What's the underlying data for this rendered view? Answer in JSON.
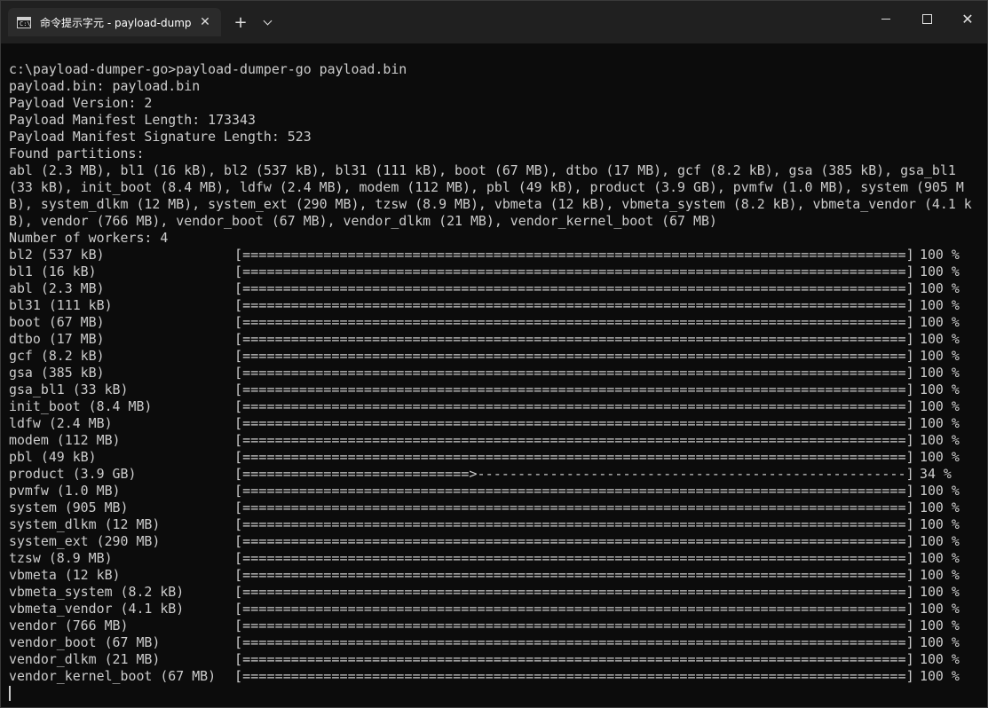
{
  "window": {
    "tab_title": "命令提示字元 - payload-dump",
    "tab_icon_text": "C:\\",
    "close_tab_glyph": "✕",
    "new_tab_glyph": "+",
    "close_glyph": "✕"
  },
  "terminal": {
    "header_lines": [
      "c:\\payload-dumper-go>payload-dumper-go payload.bin",
      "payload.bin: payload.bin",
      "Payload Version: 2",
      "Payload Manifest Length: 173343",
      "Payload Manifest Signature Length: 523",
      "Found partitions:"
    ],
    "partitions_text": "abl (2.3 MB), bl1 (16 kB), bl2 (537 kB), bl31 (111 kB), boot (67 MB), dtbo (17 MB), gcf (8.2 kB), gsa (385 kB), gsa_bl1 (33 kB), init_boot (8.4 MB), ldfw (2.4 MB), modem (112 MB), pbl (49 kB), product (3.9 GB), pvmfw (1.0 MB), system (905 MB), system_dlkm (12 MB), system_ext (290 MB), tzsw (8.9 MB), vbmeta (12 kB), vbmeta_system (8.2 kB), vbmeta_vendor (4.1 kB), vendor (766 MB), vendor_boot (67 MB), vendor_dlkm (21 MB), vendor_kernel_boot (67 MB)",
    "workers_line": "Number of workers: 4",
    "progress": [
      {
        "name": "bl2 (537 kB)",
        "bar": "[==================================================================================]",
        "pct": "100 %",
        "value": 100
      },
      {
        "name": "bl1 (16 kB)",
        "bar": "[==================================================================================]",
        "pct": "100 %",
        "value": 100
      },
      {
        "name": "abl (2.3 MB)",
        "bar": "[==================================================================================]",
        "pct": "100 %",
        "value": 100
      },
      {
        "name": "bl31 (111 kB)",
        "bar": "[==================================================================================]",
        "pct": "100 %",
        "value": 100
      },
      {
        "name": "boot (67 MB)",
        "bar": "[==================================================================================]",
        "pct": "100 %",
        "value": 100
      },
      {
        "name": "dtbo (17 MB)",
        "bar": "[==================================================================================]",
        "pct": "100 %",
        "value": 100
      },
      {
        "name": "gcf (8.2 kB)",
        "bar": "[==================================================================================]",
        "pct": "100 %",
        "value": 100
      },
      {
        "name": "gsa (385 kB)",
        "bar": "[==================================================================================]",
        "pct": "100 %",
        "value": 100
      },
      {
        "name": "gsa_bl1 (33 kB)",
        "bar": "[==================================================================================]",
        "pct": "100 %",
        "value": 100
      },
      {
        "name": "init_boot (8.4 MB)",
        "bar": "[==================================================================================]",
        "pct": "100 %",
        "value": 100
      },
      {
        "name": "ldfw (2.4 MB)",
        "bar": "[==================================================================================]",
        "pct": "100 %",
        "value": 100
      },
      {
        "name": "modem (112 MB)",
        "bar": "[==================================================================================]",
        "pct": "100 %",
        "value": 100
      },
      {
        "name": "pbl (49 kB)",
        "bar": "[==================================================================================]",
        "pct": "100 %",
        "value": 100
      },
      {
        "name": "product (3.9 GB)",
        "bar": "[============================>-----------------------------------------------------]",
        "pct": "34 %",
        "value": 34
      },
      {
        "name": "pvmfw (1.0 MB)",
        "bar": "[==================================================================================]",
        "pct": "100 %",
        "value": 100
      },
      {
        "name": "system (905 MB)",
        "bar": "[==================================================================================]",
        "pct": "100 %",
        "value": 100
      },
      {
        "name": "system_dlkm (12 MB)",
        "bar": "[==================================================================================]",
        "pct": "100 %",
        "value": 100
      },
      {
        "name": "system_ext (290 MB)",
        "bar": "[==================================================================================]",
        "pct": "100 %",
        "value": 100
      },
      {
        "name": "tzsw (8.9 MB)",
        "bar": "[==================================================================================]",
        "pct": "100 %",
        "value": 100
      },
      {
        "name": "vbmeta (12 kB)",
        "bar": "[==================================================================================]",
        "pct": "100 %",
        "value": 100
      },
      {
        "name": "vbmeta_system (8.2 kB)",
        "bar": "[==================================================================================]",
        "pct": "100 %",
        "value": 100
      },
      {
        "name": "vbmeta_vendor (4.1 kB)",
        "bar": "[==================================================================================]",
        "pct": "100 %",
        "value": 100
      },
      {
        "name": "vendor (766 MB)",
        "bar": "[==================================================================================]",
        "pct": "100 %",
        "value": 100
      },
      {
        "name": "vendor_boot (67 MB)",
        "bar": "[==================================================================================]",
        "pct": "100 %",
        "value": 100
      },
      {
        "name": "vendor_dlkm (21 MB)",
        "bar": "[==================================================================================]",
        "pct": "100 %",
        "value": 100
      },
      {
        "name": "vendor_kernel_boot (67 MB)",
        "bar": "[==================================================================================]",
        "pct": "100 %",
        "value": 100
      }
    ]
  },
  "colors": {
    "terminal_bg": "#0c0c0c",
    "terminal_fg": "#cccccc",
    "titlebar_bg": "#202020",
    "tab_bg": "#2b2b2b"
  }
}
